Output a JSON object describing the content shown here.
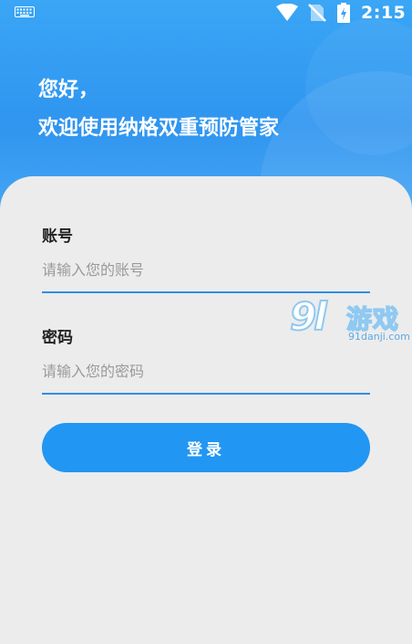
{
  "status_bar": {
    "time": "2:15",
    "icons": [
      "keyboard-icon",
      "wifi-icon",
      "no-sim-icon",
      "battery-charging-icon"
    ]
  },
  "header": {
    "greeting": "您好，",
    "welcome": "欢迎使用纳格双重预防管家"
  },
  "form": {
    "account_label": "账号",
    "account_placeholder": "请输入您的账号",
    "account_value": "",
    "password_label": "密码",
    "password_placeholder": "请输入您的密码",
    "password_value": "",
    "login_label": "登录"
  },
  "watermark": {
    "logo": "9l",
    "text": "游戏",
    "url": "91danji.com"
  },
  "colors": {
    "header_blue": "#2f95f0",
    "button_blue": "#2196f3",
    "underline_blue": "#2f8fea",
    "background": "#ececec"
  }
}
